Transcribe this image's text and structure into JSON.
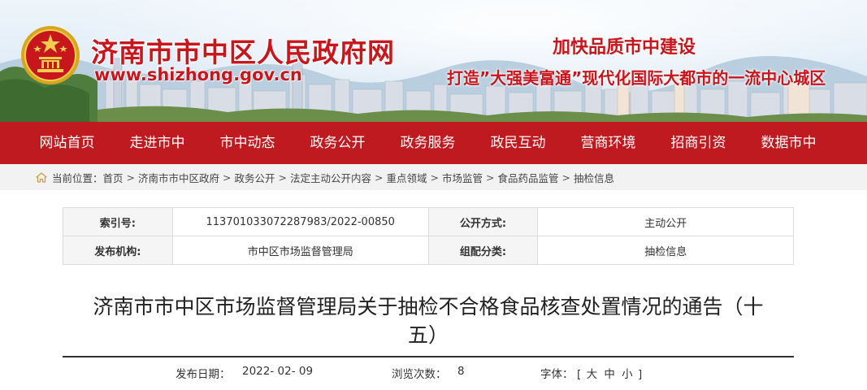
{
  "banner": {
    "site_title": "济南市市中区人民政府网",
    "site_url": "www.shizhong.gov.cn",
    "slogan_1": "加快品质市中建设",
    "slogan_2": "打造”大强美富通”现代化国际大都市的一流中心城区",
    "emblem_icon": "national-emblem-icon",
    "colors": {
      "brand_red": "#c8161d",
      "nav_red": "#bf1a20"
    }
  },
  "nav": {
    "items": [
      {
        "label": "网站首页"
      },
      {
        "label": "走进市中"
      },
      {
        "label": "市中动态"
      },
      {
        "label": "政务公开"
      },
      {
        "label": "政务服务"
      },
      {
        "label": "政民互动"
      },
      {
        "label": "营商环境"
      },
      {
        "label": "招商引资"
      },
      {
        "label": "数据市中"
      }
    ]
  },
  "breadcrumb": {
    "prefix": "当前位置：",
    "home_icon": "home-icon",
    "separator": ">",
    "items": [
      "首页",
      "济南市市中区政府",
      "政务公开",
      "法定主动公开内容",
      "重点领域",
      "市场监管",
      "食品药品监管",
      "抽检信息"
    ]
  },
  "meta": {
    "index_label": "索引号:",
    "index_value": "113701033072287983/2022-00850",
    "disclosure_label": "公开方式:",
    "disclosure_value": "主动公开",
    "publisher_label": "发布机构:",
    "publisher_value": "市中区市场监督管理局",
    "category_label": "组配分类:",
    "category_value": "抽检信息"
  },
  "article": {
    "title": "济南市市中区市场监督管理局关于抽检不合格食品核查处置情况的通告（十五）",
    "date_label": "发布日期：",
    "date_value": "2022- 02- 09",
    "views_label": "浏览次数：",
    "views_value": "8",
    "font_label": "字体：",
    "font_open": "[",
    "font_large": "大",
    "font_medium": "中",
    "font_small": "小",
    "font_close": "]"
  }
}
